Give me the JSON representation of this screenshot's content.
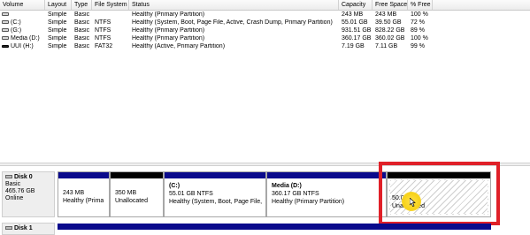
{
  "columns": {
    "volume": "Volume",
    "layout": "Layout",
    "type": "Type",
    "filesystem": "File System",
    "status": "Status",
    "capacity": "Capacity",
    "free_space": "Free Space",
    "pct_free": "% Free"
  },
  "volumes": [
    {
      "name": "",
      "layout": "Simple",
      "type": "Basic",
      "fs": "",
      "status": "Healthy (Primary Partition)",
      "capacity": "243 MB",
      "free": "243 MB",
      "pct": "100 %",
      "icon": "hdd-icon"
    },
    {
      "name": "(C:)",
      "layout": "Simple",
      "type": "Basic",
      "fs": "NTFS",
      "status": "Healthy (System, Boot, Page File, Active, Crash Dump, Primary Partition)",
      "capacity": "55.01 GB",
      "free": "39.50 GB",
      "pct": "72 %",
      "icon": "hdd-icon"
    },
    {
      "name": "(G:)",
      "layout": "Simple",
      "type": "Basic",
      "fs": "NTFS",
      "status": "Healthy (Primary Partition)",
      "capacity": "931.51 GB",
      "free": "828.22 GB",
      "pct": "89 %",
      "icon": "hdd-icon"
    },
    {
      "name": "Media (D:)",
      "layout": "Simple",
      "type": "Basic",
      "fs": "NTFS",
      "status": "Healthy (Primary Partition)",
      "capacity": "360.17 GB",
      "free": "360.02 GB",
      "pct": "100 %",
      "icon": "hdd-icon"
    },
    {
      "name": "UUI (H:)",
      "layout": "Simple",
      "type": "Basic",
      "fs": "FAT32",
      "status": "Healthy (Active, Primary Partition)",
      "capacity": "7.19 GB",
      "free": "7.11 GB",
      "pct": "99 %",
      "icon": "usb-drive-icon"
    }
  ],
  "disk0": {
    "name": "Disk 0",
    "type": "Basic",
    "size": "465.76 GB",
    "state": "Online",
    "partitions": [
      {
        "name": "",
        "size": "243 MB",
        "status": "Healthy (Prima",
        "bar_color": "#0a0a8c"
      },
      {
        "name": "",
        "size": "350 MB",
        "status": "Unallocated",
        "bar_color": "#000000"
      },
      {
        "name": "(C:)",
        "size": "55.01 GB NTFS",
        "status": "Healthy (System, Boot, Page File,",
        "bar_color": "#0a0a8c"
      },
      {
        "name": "Media  (D:)",
        "size": "360.17 GB NTFS",
        "status": "Healthy (Primary Partition)",
        "bar_color": "#0a0a8c"
      },
      {
        "name": "",
        "size": "50.00 GB",
        "status": "Unallocated",
        "bar_color": "#000000"
      }
    ]
  },
  "disk1": {
    "name": "Disk 1"
  },
  "colors": {
    "primary_partition": "#0a0a8c",
    "unallocated": "#000000",
    "highlight": "#e02028",
    "cursor_halo": "#f7d21a"
  }
}
